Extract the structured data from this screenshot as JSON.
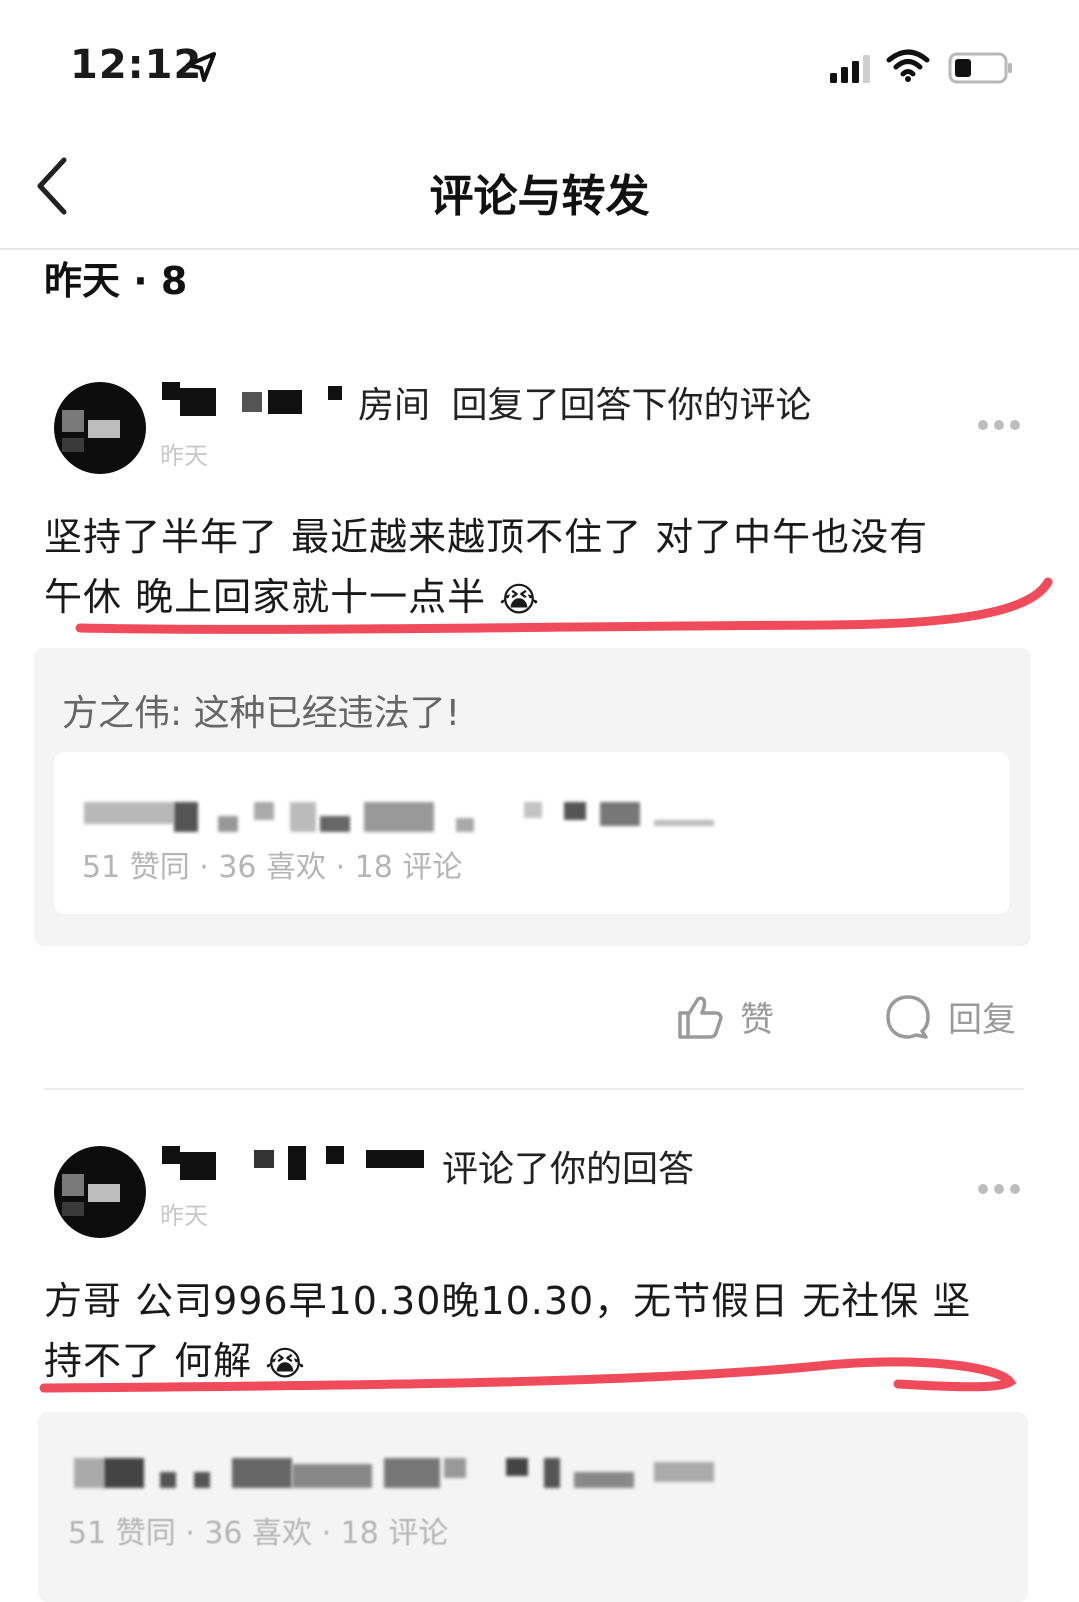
{
  "status_bar": {
    "time": "12:12"
  },
  "nav": {
    "title": "评论与转发"
  },
  "section": {
    "date_label": "昨天 · 8"
  },
  "notifications": [
    {
      "user_suffix": "房间",
      "action": "回复了回答下你的评论",
      "time": "昨天",
      "comment_line1": "坚持了半年了 最近越来越顶不住了 对了中午也没有",
      "comment_line2": "午休 晚上回家就十一点半 ",
      "emoji": "😭",
      "quote": "方之伟: 这种已经违法了!",
      "answer_stats": "51 赞同 · 36 喜欢 · 18 评论",
      "like_label": "赞",
      "reply_label": "回复"
    },
    {
      "user_suffix": "",
      "action": "评论了你的回答",
      "time": "昨天",
      "comment_line1": "方哥 公司996早10.30晚10.30，无节假日 无社保 坚",
      "comment_line2": "持不了 何解 ",
      "emoji": "😭",
      "answer_stats": "51 赞同 · 36 喜欢 · 18 评论"
    }
  ],
  "colors": {
    "underline": "#ef4b5a",
    "quote_bg": "#f4f4f4"
  }
}
